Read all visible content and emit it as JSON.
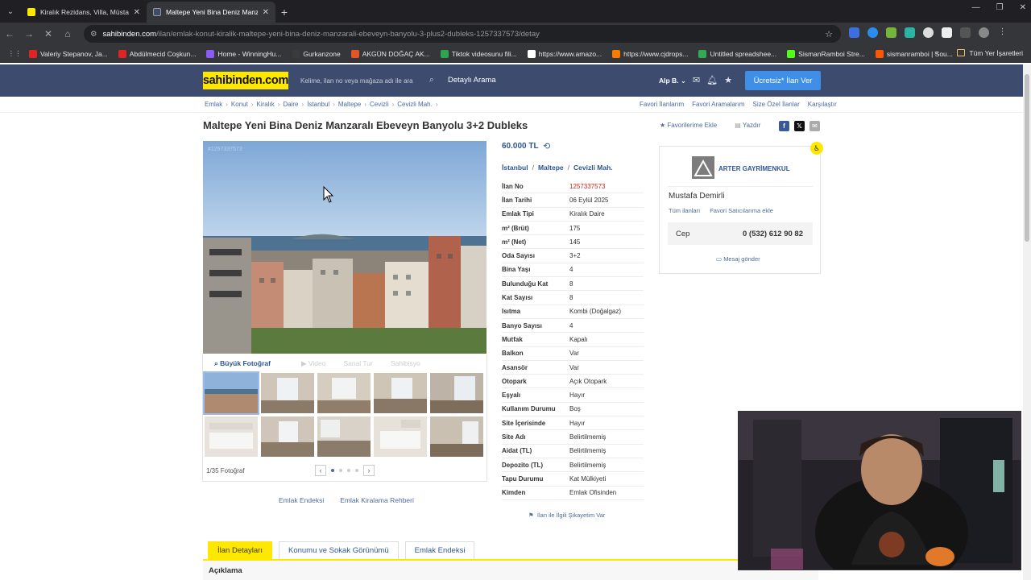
{
  "browser": {
    "tabs": [
      {
        "title": "Kiralık Rezidans, Villa, Müstakil",
        "active": false,
        "favicon_color": "#ffe800"
      },
      {
        "title": "Maltepe Yeni Bina Deniz Manzar",
        "active": true,
        "favicon_color": "#3c4b6e"
      }
    ],
    "url_host": "sahibinden.com",
    "url_path": "/ilan/emlak-konut-kiralik-maltepe-yeni-bina-deniz-manzarali-ebeveyn-banyolu-3-plus2-dubleks-1257337573/detay",
    "bookmarks": [
      {
        "label": "Valeriy Stepanov, Ja...",
        "color": "#e02424"
      },
      {
        "label": "Abdülmecid Coşkun...",
        "color": "#e02424"
      },
      {
        "label": "Home - WinningHu...",
        "color": "#8a5cf5"
      },
      {
        "label": "Gurkanzone",
        "color": "#3a3a3a"
      },
      {
        "label": "AKGÜN DOĞAÇ AK...",
        "color": "#e25525"
      },
      {
        "label": "Tiktok videosunu fili...",
        "color": "#2ea44f"
      },
      {
        "label": "https://www.amazo...",
        "color": "#ffffff"
      },
      {
        "label": "https://www.cjdrops...",
        "color": "#f57c00"
      },
      {
        "label": "Untitled spreadshee...",
        "color": "#34a853"
      },
      {
        "label": "SismanRamboi Stre...",
        "color": "#53fc18"
      },
      {
        "label": "sismanramboi | Sou...",
        "color": "#ff5500"
      }
    ],
    "all_bookmarks": "Tüm Yer İşaretleri"
  },
  "header": {
    "logo": "sahibinden.com",
    "search_placeholder": "Kelime, ilan no veya mağaza adı ile ara",
    "advanced_search": "Detaylı Arama",
    "user": "Alp B.",
    "post_button": "Ücretsiz* İlan Ver"
  },
  "breadcrumb": [
    "Emlak",
    "Konut",
    "Kiralık",
    "Daire",
    "İstanbul",
    "Maltepe",
    "Cevizli",
    "Cevizli Mah."
  ],
  "breadcrumb_right": [
    "Favori İlanlarım",
    "Favori Aramalarım",
    "Size Özel İlanlar",
    "Karşılaştır"
  ],
  "listing": {
    "title": "Maltepe Yeni Bina Deniz Manzaralı Ebeveyn Banyolu 3+2 Dubleks",
    "add_favorite": "Favorilerime Ekle",
    "print": "Yazdır",
    "photo_id": "#1257337573",
    "big_photo": "Büyük Fotoğraf",
    "video": "Video",
    "virtual_tour": "Sanal Tur",
    "satellite": "Sahibisyo",
    "photo_count": "1/35 Fotoğraf",
    "below_links": [
      "Emlak Endeksi",
      "Emlak Kiralama Rehberi"
    ],
    "price": "60.000 TL",
    "location": [
      "İstanbul",
      "Maltepe",
      "Cevizli Mah."
    ],
    "specs": [
      {
        "k": "İlan No",
        "v": "1257337573",
        "red": true
      },
      {
        "k": "İlan Tarihi",
        "v": "06 Eylül 2025"
      },
      {
        "k": "Emlak Tipi",
        "v": "Kiralık Daire"
      },
      {
        "k": "m² (Brüt)",
        "v": "175"
      },
      {
        "k": "m² (Net)",
        "v": "145"
      },
      {
        "k": "Oda Sayısı",
        "v": "3+2"
      },
      {
        "k": "Bina Yaşı",
        "v": "4"
      },
      {
        "k": "Bulunduğu Kat",
        "v": "8"
      },
      {
        "k": "Kat Sayısı",
        "v": "8"
      },
      {
        "k": "Isıtma",
        "v": "Kombi (Doğalgaz)"
      },
      {
        "k": "Banyo Sayısı",
        "v": "4"
      },
      {
        "k": "Mutfak",
        "v": "Kapalı"
      },
      {
        "k": "Balkon",
        "v": "Var"
      },
      {
        "k": "Asansör",
        "v": "Var"
      },
      {
        "k": "Otopark",
        "v": "Açık Otopark"
      },
      {
        "k": "Eşyalı",
        "v": "Hayır"
      },
      {
        "k": "Kullanım Durumu",
        "v": "Boş"
      },
      {
        "k": "Site İçerisinde",
        "v": "Hayır"
      },
      {
        "k": "Site Adı",
        "v": "Belirtilmemiş"
      },
      {
        "k": "Aidat (TL)",
        "v": "Belirtilmemiş"
      },
      {
        "k": "Depozito (TL)",
        "v": "Belirtilmemiş"
      },
      {
        "k": "Tapu Durumu",
        "v": "Kat Mülkiyeti"
      },
      {
        "k": "Kimden",
        "v": "Emlak Ofisinden"
      }
    ],
    "complaint": "İlan ile İlgili Şikayetim Var"
  },
  "seller": {
    "company": "ARTER GAYRİMENKUL",
    "name": "Mustafa Demirli",
    "all_listings": "Tüm ilanları",
    "add_favorite_seller": "Favori Satıcılarıma ekle",
    "phone_label": "Cep",
    "phone": "0 (532) 612 90 82",
    "send_message": "Mesaj gönder"
  },
  "detail_tabs": [
    "İlan Detayları",
    "Konumu ve Sokak Görünümü",
    "Emlak Endeksi"
  ],
  "description_heading": "Açıklama"
}
